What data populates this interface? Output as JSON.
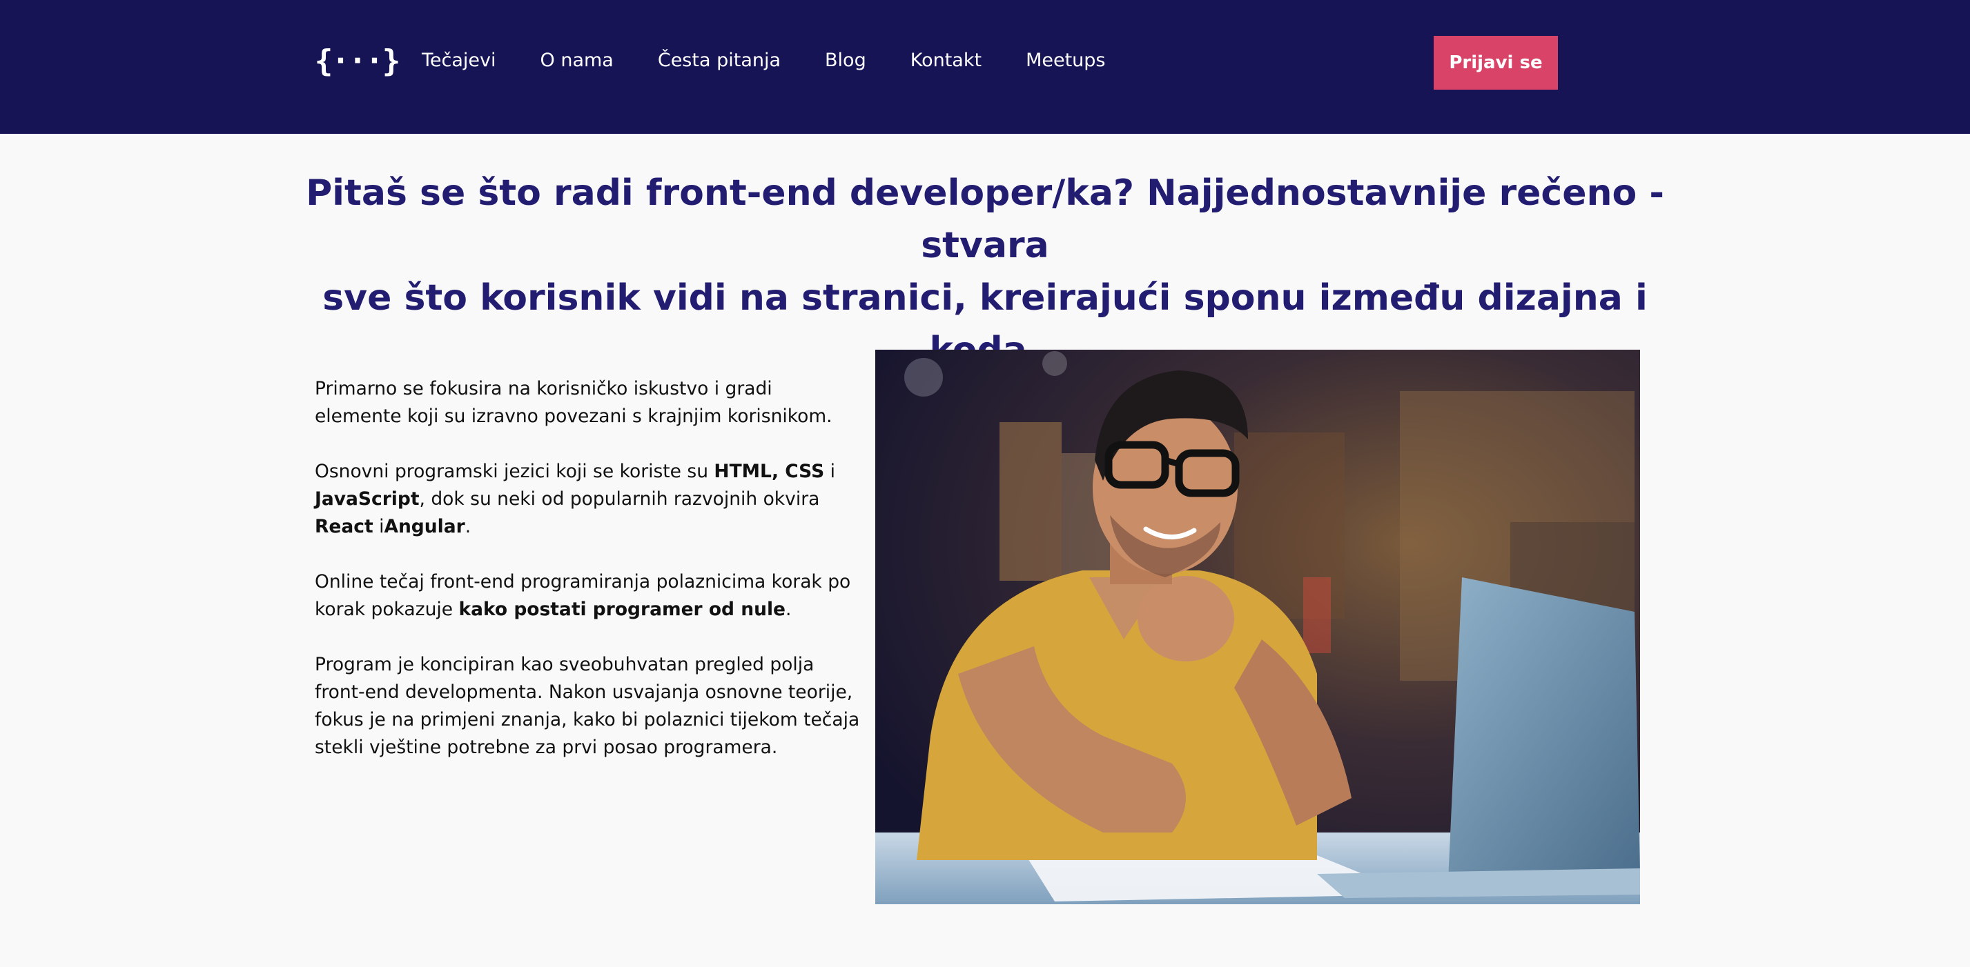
{
  "header": {
    "logo_text": "{···}",
    "nav": [
      {
        "label": "Tečajevi"
      },
      {
        "label": "O nama"
      },
      {
        "label": "Česta pitanja"
      },
      {
        "label": "Blog"
      },
      {
        "label": "Kontakt"
      },
      {
        "label": "Meetups"
      }
    ],
    "login_label": "Prijavi se"
  },
  "main": {
    "headline_line1": "Pitaš se što radi front-end developer/ka? Najjednostavnije rečeno - stvara",
    "headline_line2": "sve što korisnik vidi na stranici, kreirajući sponu između dizajna i koda.",
    "p1": "Primarno se fokusira na korisničko iskustvo i gradi elemente koji su izravno povezani s krajnjim korisnikom.",
    "p2_start": "Osnovni programski jezici koji se koriste su ",
    "p2_html": "HTML",
    "p2_comma": ", ",
    "p2_css": "CSS",
    "p2_and": " i ",
    "p2_js": "JavaScript",
    "p2_mid": ", dok su neki od popularnih razvojnih okvira ",
    "p2_react": "React",
    "p2_i": " i",
    "p2_angular": "Angular",
    "p2_end": ".",
    "p3_start": "Online tečaj front-end programiranja polaznicima korak po korak pokazuje ",
    "p3_bold": "kako postati programer od nule",
    "p3_end": ".",
    "p4": "Program je koncipiran kao sveobuhvatan pregled polja front-end developmenta. Nakon usvajanja osnovne teorije, fokus je na primjeni znanja, kako bi polaznici tijekom tečaja stekli vještine potrebne za prvi posao programera."
  },
  "colors": {
    "header_bg": "#161455",
    "accent": "#d94368",
    "headline": "#231d72"
  }
}
